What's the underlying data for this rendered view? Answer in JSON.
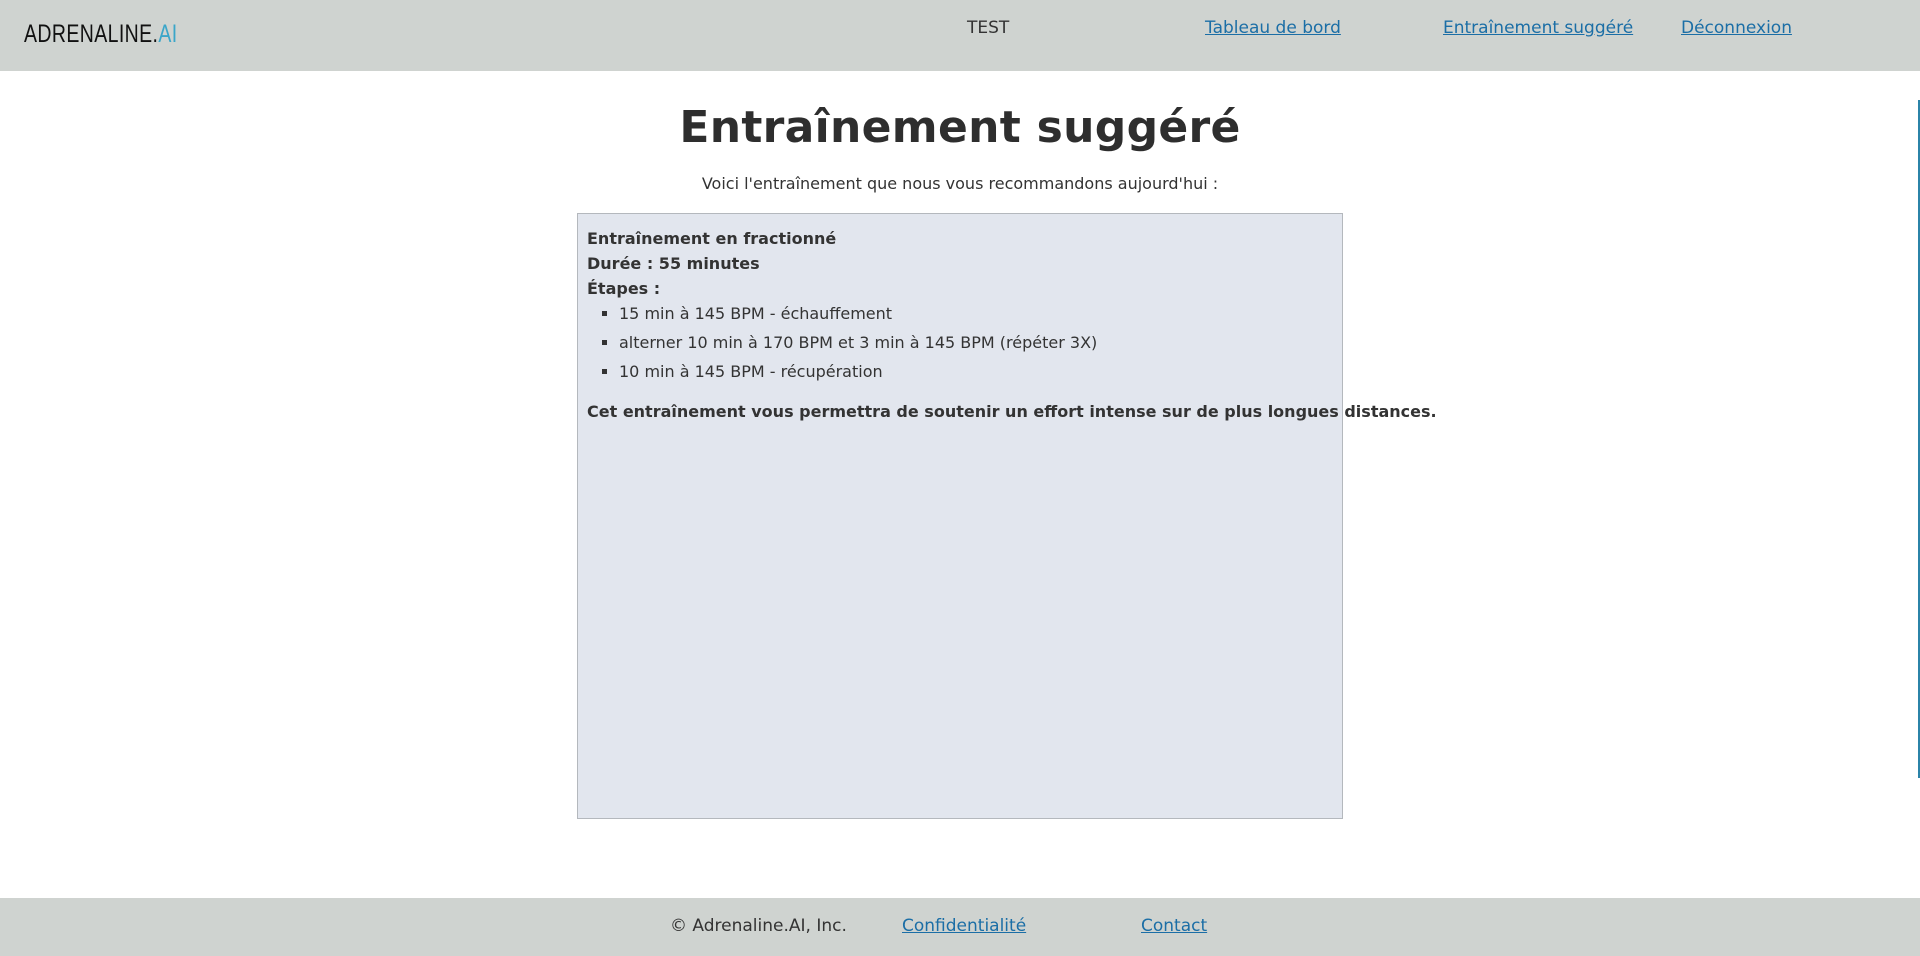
{
  "header": {
    "logo_main": "ADRENALINE.",
    "logo_accent": "AI",
    "user_name": "TEST",
    "nav": {
      "dashboard": "Tableau de bord",
      "training": "Entraînement suggéré",
      "logout": "Déconnexion"
    }
  },
  "main": {
    "title": "Entraînement suggéré",
    "subtitle": "Voici l'entraînement que nous vous recommandons aujourd'hui :",
    "workout": {
      "name": "Entraînement en fractionné",
      "duration": "Durée : 55 minutes",
      "steps_label": "Étapes :",
      "steps": [
        "15 min à 145 BPM - échauffement",
        "alterner 10 min à 170 BPM et 3 min à 145 BPM (répéter 3X)",
        "10 min à 145 BPM - récupération"
      ],
      "outro": "Cet entraînement vous permettra de soutenir un effort intense sur de plus longues distances."
    }
  },
  "footer": {
    "copyright": "© Adrenaline.AI, Inc.",
    "privacy": "Confidentialité",
    "contact": "Contact"
  },
  "colors": {
    "header_bg": "#cfd3d0",
    "link": "#1b6ea6",
    "logo_accent": "#3aa6c9",
    "card_bg": "#e2e6ee"
  }
}
